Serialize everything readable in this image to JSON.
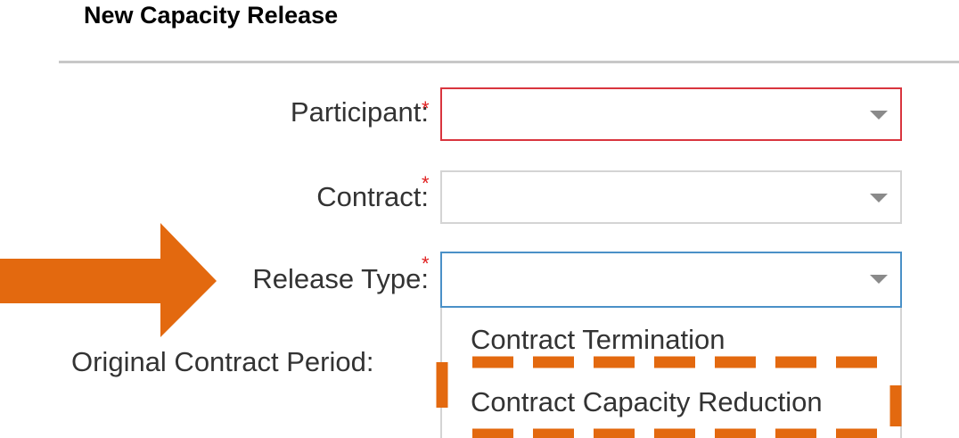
{
  "page": {
    "title": "New Capacity Release"
  },
  "form": {
    "participant": {
      "label": "Participant:",
      "required_marker": "*",
      "value": "",
      "state": "invalid"
    },
    "contract": {
      "label": "Contract:",
      "required_marker": "*",
      "value": ""
    },
    "release_type": {
      "label": "Release Type:",
      "required_marker": "*",
      "value": "",
      "state": "open",
      "options": [
        "Contract Termination",
        "Contract Capacity Reduction"
      ]
    },
    "original_contract_period": {
      "label": "Original Contract Period:"
    }
  },
  "annotations": {
    "arrow_color": "#e3690f",
    "highlight_color": "#e3690f",
    "highlighted_option": "Contract Capacity Reduction"
  },
  "colors": {
    "required": "#e02020",
    "invalid_border": "#d9353e",
    "focus_border": "#4a90c7"
  }
}
